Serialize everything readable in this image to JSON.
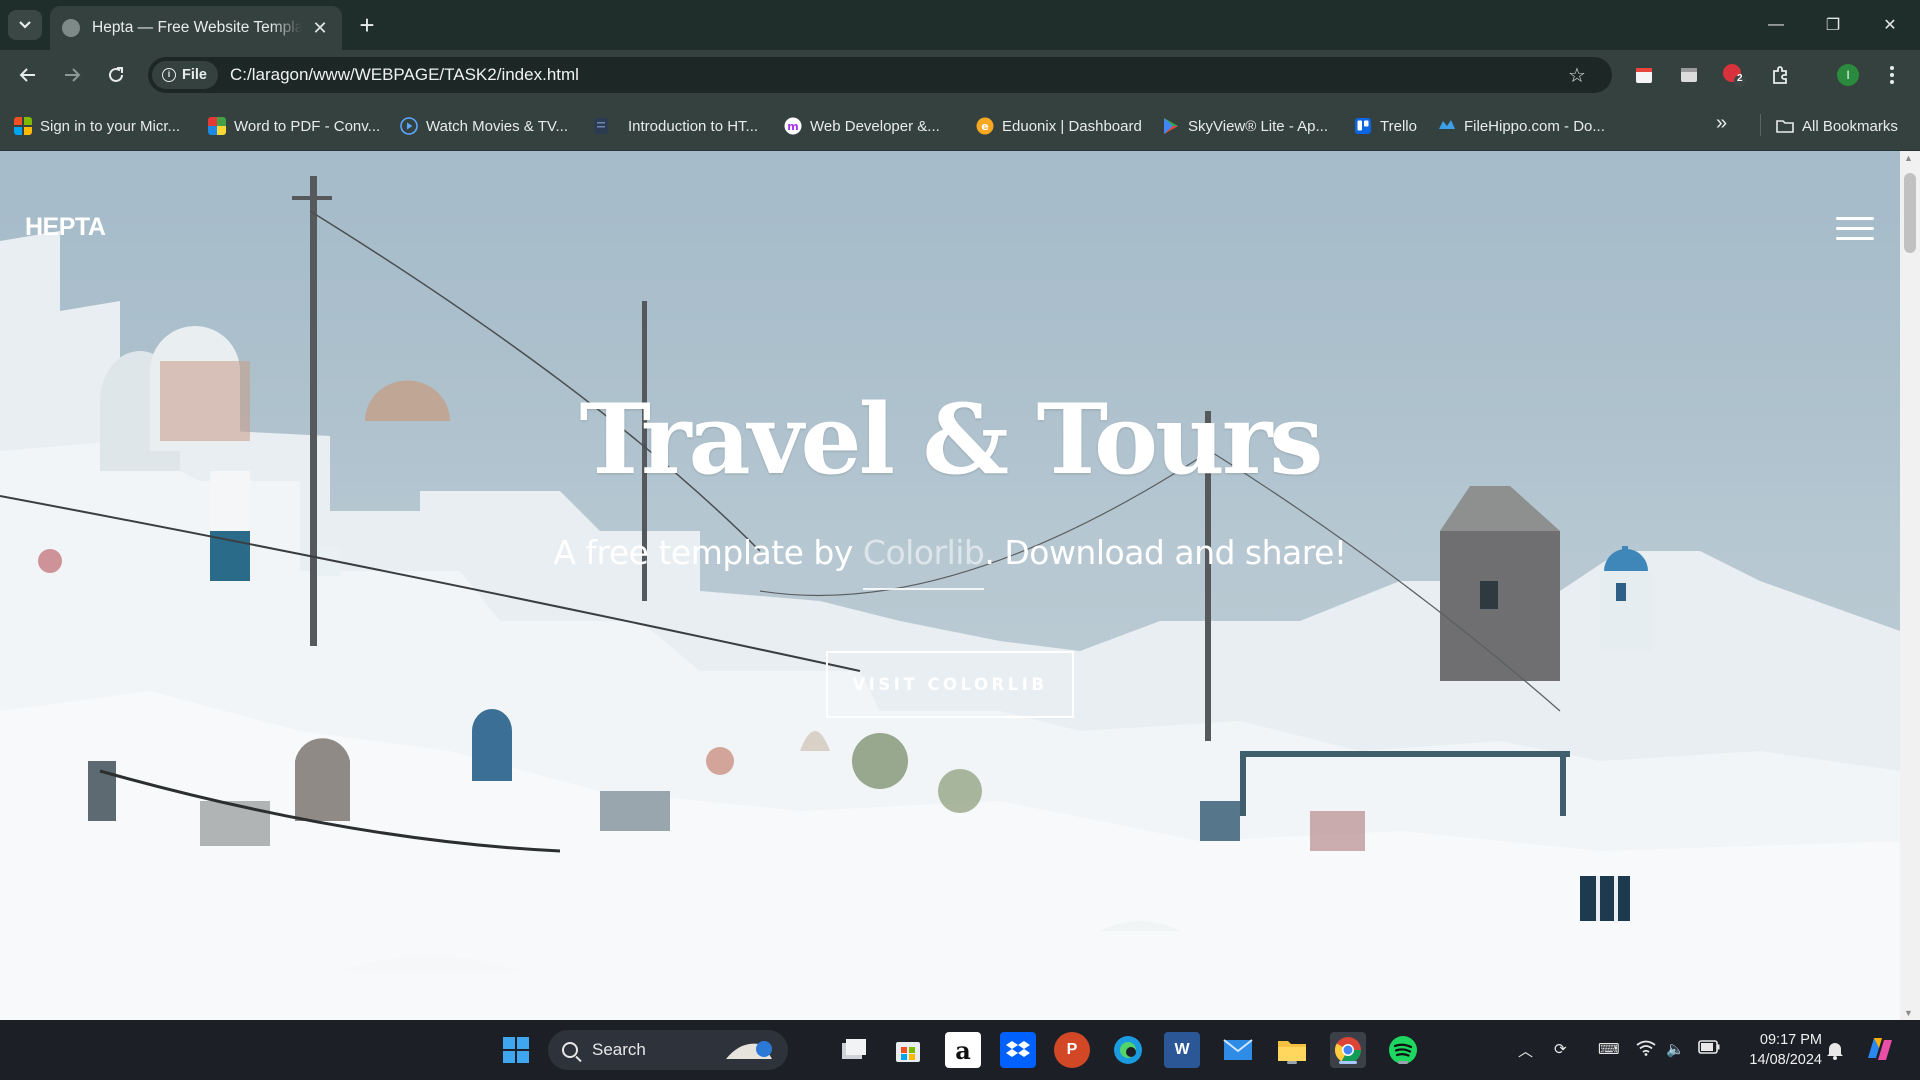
{
  "browser": {
    "tab": {
      "title": "Hepta — Free Website Template by Colorlib",
      "close": "✕"
    },
    "new_tab": "+",
    "window_controls": {
      "minimize": "—",
      "restore": "❐",
      "close": "✕"
    },
    "nav": {
      "back": "←",
      "forward": "→",
      "reload": "↻"
    },
    "site_chip": {
      "info": "i",
      "label": "File"
    },
    "url": "C:/laragon/www/WEBPAGE/TASK2/index.html",
    "extensions": {
      "profile_initial": "I",
      "badge_count": "2"
    },
    "bookmarks": [
      {
        "label": "Sign in to your Micr...",
        "icon": "microsoft-icon"
      },
      {
        "label": "Word to PDF - Conv...",
        "icon": "ilovepdf-icon"
      },
      {
        "label": "Watch Movies & TV...",
        "icon": "play-icon"
      },
      {
        "label": "Introduction to HT...",
        "icon": "doc-icon"
      },
      {
        "label": "Web Developer &...",
        "icon": "udemy-icon"
      },
      {
        "label": "Eduonix | Dashboard",
        "icon": "eduonix-icon"
      },
      {
        "label": "SkyView® Lite - Ap...",
        "icon": "google-play-icon"
      },
      {
        "label": "Trello",
        "icon": "trello-icon"
      },
      {
        "label": "FileHippo.com - Do...",
        "icon": "filehippo-icon"
      }
    ],
    "more_bookmarks": "»",
    "all_bookmarks": "All Bookmarks"
  },
  "page": {
    "brand": "HEPTA",
    "hero_title": "Travel & Tours",
    "hero_sub_before": "A free template by ",
    "hero_sub_link": "Colorlib",
    "hero_sub_after": ". Download and share!",
    "cta": "VISIT COLORLIB"
  },
  "taskbar": {
    "search_label": "Search",
    "clock_time": "09:17 PM",
    "clock_date": "14/08/2024",
    "apps": [
      "start",
      "search",
      "task-view",
      "microsoft-store",
      "amazon",
      "dropbox",
      "powerpoint",
      "edge",
      "word",
      "mail",
      "file-explorer",
      "chrome",
      "spotify"
    ],
    "word_letter": "W",
    "powerpoint_letter": "P",
    "amazon_letter": "a"
  },
  "colors": {
    "chrome_dark": "#1f2d2b",
    "chrome_toolbar": "#35413f",
    "taskbar": "#1c1f26",
    "hero_text": "#ffffff"
  }
}
